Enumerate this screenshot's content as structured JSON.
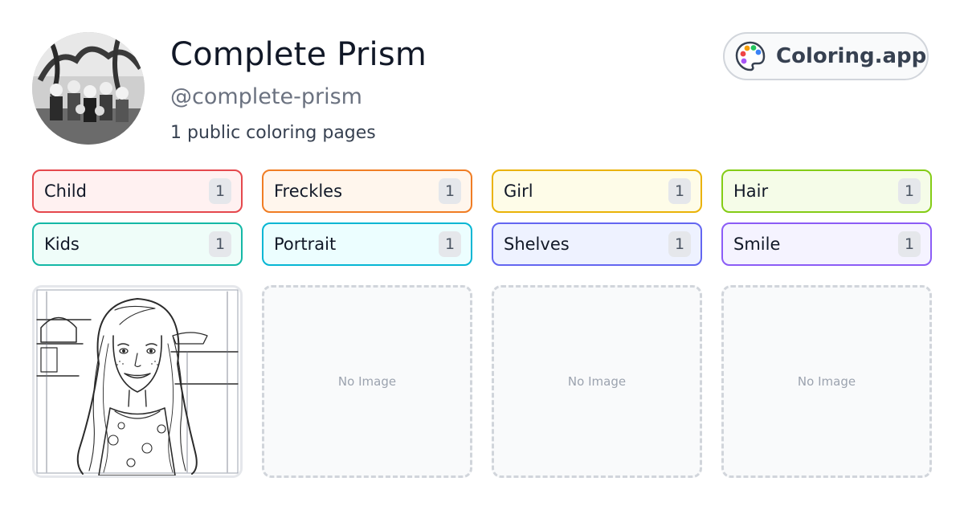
{
  "profile": {
    "name": "Complete Prism",
    "handle": "@complete-prism",
    "page_count_text": "1 public coloring pages",
    "avatar_icon": "group-photo-avatar"
  },
  "brand": {
    "name": "Coloring.app",
    "icon": "palette-icon",
    "icon_colors": [
      "#ef4444",
      "#f59e0b",
      "#22c55e",
      "#3b82f6",
      "#a855f7"
    ]
  },
  "tags": [
    {
      "label": "Child",
      "count": "1",
      "border": "#e5484d",
      "bg": "#fff1f1"
    },
    {
      "label": "Freckles",
      "count": "1",
      "border": "#f07d24",
      "bg": "#fff6ed"
    },
    {
      "label": "Girl",
      "count": "1",
      "border": "#eab308",
      "bg": "#fefce8"
    },
    {
      "label": "Hair",
      "count": "1",
      "border": "#84cc16",
      "bg": "#f5fce8"
    },
    {
      "label": "Kids",
      "count": "1",
      "border": "#14b8a6",
      "bg": "#effdf9"
    },
    {
      "label": "Portrait",
      "count": "1",
      "border": "#06b6d4",
      "bg": "#ecfeff"
    },
    {
      "label": "Shelves",
      "count": "1",
      "border": "#6366f1",
      "bg": "#eef2ff"
    },
    {
      "label": "Smile",
      "count": "1",
      "border": "#8b5cf6",
      "bg": "#f5f3ff"
    }
  ],
  "cards": [
    {
      "type": "image",
      "subject": "girl-portrait-line-art"
    },
    {
      "type": "empty",
      "label": "No Image"
    },
    {
      "type": "empty",
      "label": "No Image"
    },
    {
      "type": "empty",
      "label": "No Image"
    }
  ]
}
